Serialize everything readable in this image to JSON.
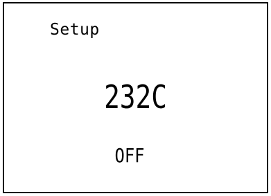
{
  "display": {
    "title": "Setup",
    "temperature": "232C",
    "status": "OFF"
  }
}
